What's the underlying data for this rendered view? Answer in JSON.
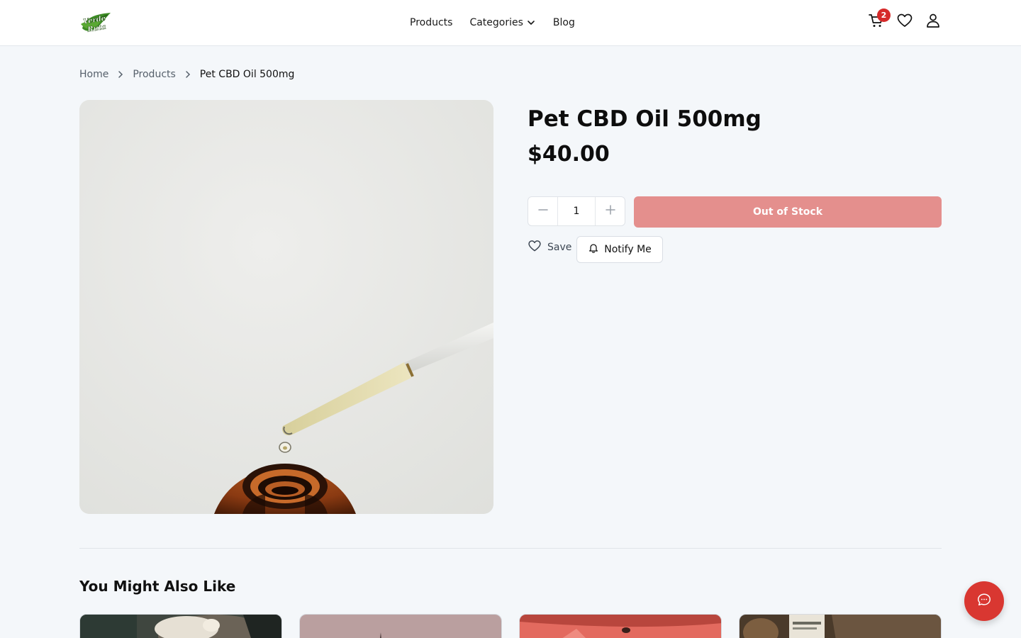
{
  "brand": {
    "logo_text": "Verde Ruta"
  },
  "nav": {
    "products": "Products",
    "categories": "Categories",
    "blog": "Blog"
  },
  "header": {
    "cart_count": "2"
  },
  "breadcrumb": {
    "home": "Home",
    "products": "Products",
    "current": "Pet CBD Oil 500mg"
  },
  "product": {
    "title": "Pet CBD Oil 500mg",
    "price": "$40.00",
    "quantity": "1",
    "stock_button": "Out of Stock",
    "save_label": "Save",
    "notify_label": "Notify Me"
  },
  "related": {
    "title": "You Might Also Like"
  },
  "colors": {
    "accent_red": "#d93731",
    "out_of_stock": "#e48f8d",
    "brand_green": "#3d8b25"
  }
}
